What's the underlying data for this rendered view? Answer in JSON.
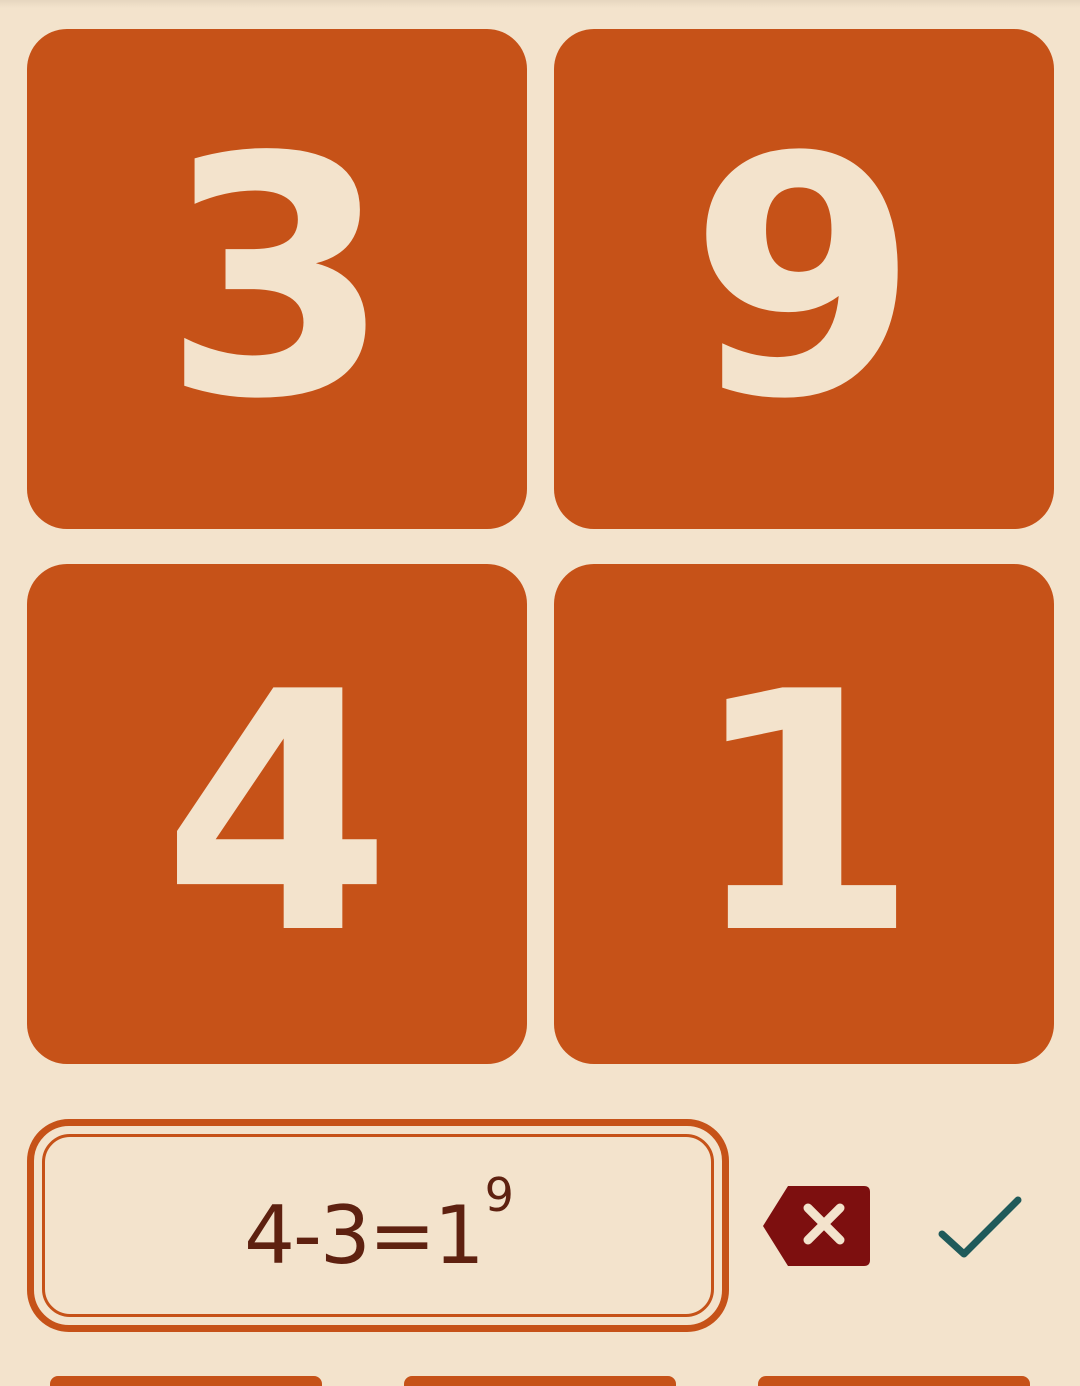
{
  "tiles": [
    "3",
    "9",
    "4",
    "1"
  ],
  "answer": {
    "expression": "4-3=1",
    "superscript": "9"
  },
  "controls": {
    "backspace_icon": "backspace-x-icon",
    "confirm_icon": "checkmark-icon"
  },
  "colors": {
    "background": "#f3e3cc",
    "tile": "#c65218",
    "tile_text": "#f3e3cc",
    "expression_text": "#5e2110",
    "backspace": "#7d0f0f",
    "confirm": "#1f5a5a"
  }
}
